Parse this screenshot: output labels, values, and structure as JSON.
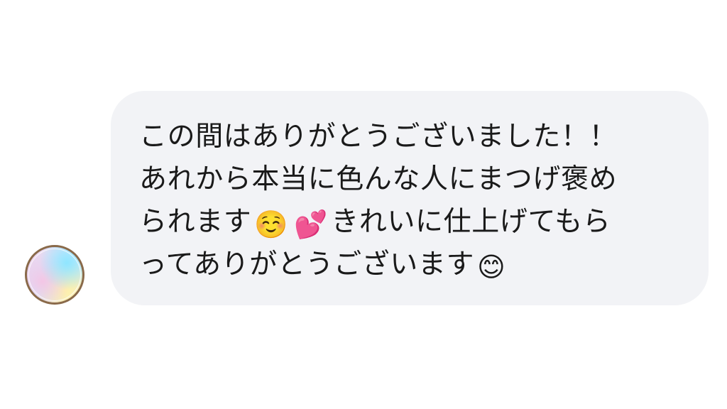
{
  "conversation": {
    "incoming_message": {
      "lines": [
        "この間はありがとうございました！！",
        "あれから本当に色んな人にまつげ褒め",
        "られます",
        "きれいに仕上げてもら",
        "ってありがとうございます"
      ],
      "emoji": {
        "relieved": "☺️",
        "two_hearts": "💕",
        "smile": "😊"
      }
    },
    "avatar": {
      "icon": "profile-avatar-icon"
    },
    "colors": {
      "bubble_background": "#f2f3f6",
      "text": "#1a1a1a",
      "avatar_border": "#8a6a4a"
    }
  }
}
